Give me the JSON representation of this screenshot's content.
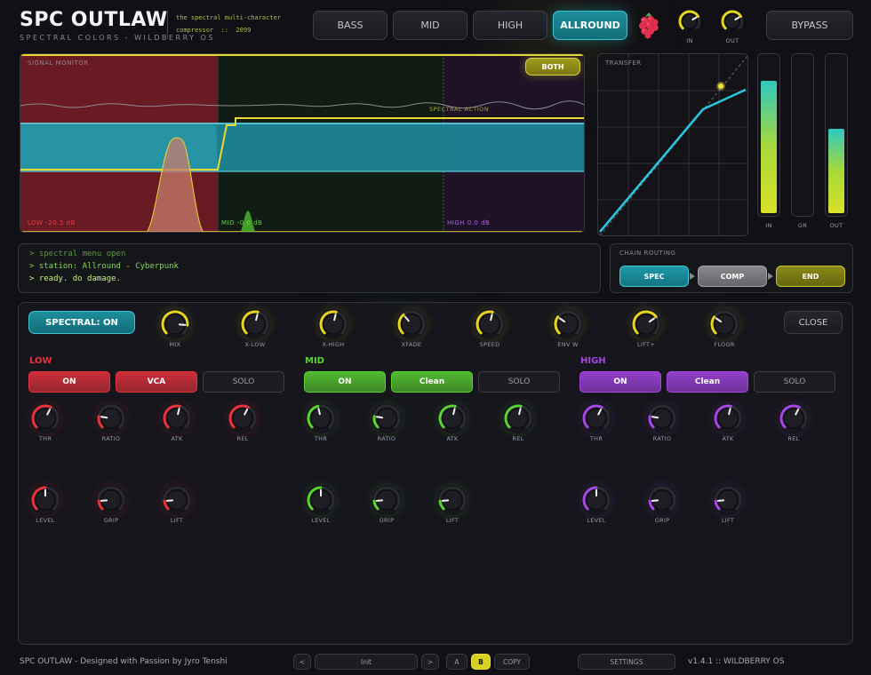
{
  "header": {
    "title": "SPC OUTLAW",
    "subtitle": "SPECTRAL COLORS - WILDBERRY OS",
    "tagline": "the spectral multi-character\ncompressor  ::  2099"
  },
  "modes": [
    {
      "label": "BASS",
      "active": false
    },
    {
      "label": "MID",
      "active": false
    },
    {
      "label": "HIGH",
      "active": false
    },
    {
      "label": "ALLROUND",
      "active": true
    }
  ],
  "io_knobs": {
    "in_label": "IN",
    "out_label": "OUT",
    "in_value": 0.72,
    "out_value": 0.72
  },
  "bypass_label": "BYPASS",
  "monitor": {
    "title": "SIGNAL MONITOR",
    "toggle_label": "BOTH",
    "action_label": "SPECTRAL ACTION",
    "low_label": "LOW -20.5 dB",
    "mid_label": "MID -0.0 dB",
    "high_label": "HIGH 0.0 dB"
  },
  "transfer": {
    "title": "TRANSFER"
  },
  "meters": {
    "in_label": "IN",
    "gr_label": "GR",
    "out_label": "OUT",
    "in_level": 0.82,
    "gr_level": 0.0,
    "out_level": 0.52
  },
  "console": {
    "lines": [
      "> spectral menu open",
      "> station: Allround - Cyberpunk",
      "> ready. do damage."
    ]
  },
  "chain": {
    "title": "CHAIN ROUTING",
    "steps": [
      "SPEC",
      "COMP",
      "END"
    ]
  },
  "spectral_button": "SPECTRAL: ON",
  "close_label": "CLOSE",
  "global_knobs": [
    {
      "label": "MIX",
      "value": 0.85
    },
    {
      "label": "X-LOW",
      "value": 0.55
    },
    {
      "label": "X-HIGH",
      "value": 0.55
    },
    {
      "label": "XFADE",
      "value": 0.35
    },
    {
      "label": "SPEED",
      "value": 0.55
    },
    {
      "label": "ENV W",
      "value": 0.3
    },
    {
      "label": "LIFT+",
      "value": 0.7
    },
    {
      "label": "FLOOR",
      "value": 0.3
    }
  ],
  "bands": [
    {
      "name": "LOW",
      "color": "#e8323c",
      "buttons": [
        "ON",
        "VCA",
        "SOLO"
      ],
      "knobs": [
        {
          "label": "THR",
          "value": 0.6
        },
        {
          "label": "RATIO",
          "value": 0.2
        },
        {
          "label": "ATK",
          "value": 0.55
        },
        {
          "label": "REL",
          "value": 0.6
        },
        {
          "label": "LEVEL",
          "value": 0.5
        },
        {
          "label": "GRIP",
          "value": 0.15
        },
        {
          "label": "LIFT",
          "value": 0.15
        }
      ]
    },
    {
      "name": "MID",
      "color": "#5ad232",
      "buttons": [
        "ON",
        "Clean",
        "SOLO"
      ],
      "knobs": [
        {
          "label": "THR",
          "value": 0.45
        },
        {
          "label": "RATIO",
          "value": 0.2
        },
        {
          "label": "ATK",
          "value": 0.55
        },
        {
          "label": "REL",
          "value": 0.55
        },
        {
          "label": "LEVEL",
          "value": 0.5
        },
        {
          "label": "GRIP",
          "value": 0.15
        },
        {
          "label": "LIFT",
          "value": 0.15
        }
      ]
    },
    {
      "name": "HIGH",
      "color": "#a646e6",
      "buttons": [
        "ON",
        "Clean",
        "SOLO"
      ],
      "knobs": [
        {
          "label": "THR",
          "value": 0.6
        },
        {
          "label": "RATIO",
          "value": 0.2
        },
        {
          "label": "ATK",
          "value": 0.55
        },
        {
          "label": "REL",
          "value": 0.6
        },
        {
          "label": "LEVEL",
          "value": 0.5
        },
        {
          "label": "GRIP",
          "value": 0.15
        },
        {
          "label": "LIFT",
          "value": 0.15
        }
      ]
    }
  ],
  "footer": {
    "credit": "SPC OUTLAW  -  Designed with Passion by Jyro Tenshi",
    "prev": "<",
    "preset": "Init",
    "next": ">",
    "a": "A",
    "b": "B",
    "copy": "COPY",
    "settings": "SETTINGS",
    "version": "v1.4.1  ::  WILDBERRY OS"
  }
}
